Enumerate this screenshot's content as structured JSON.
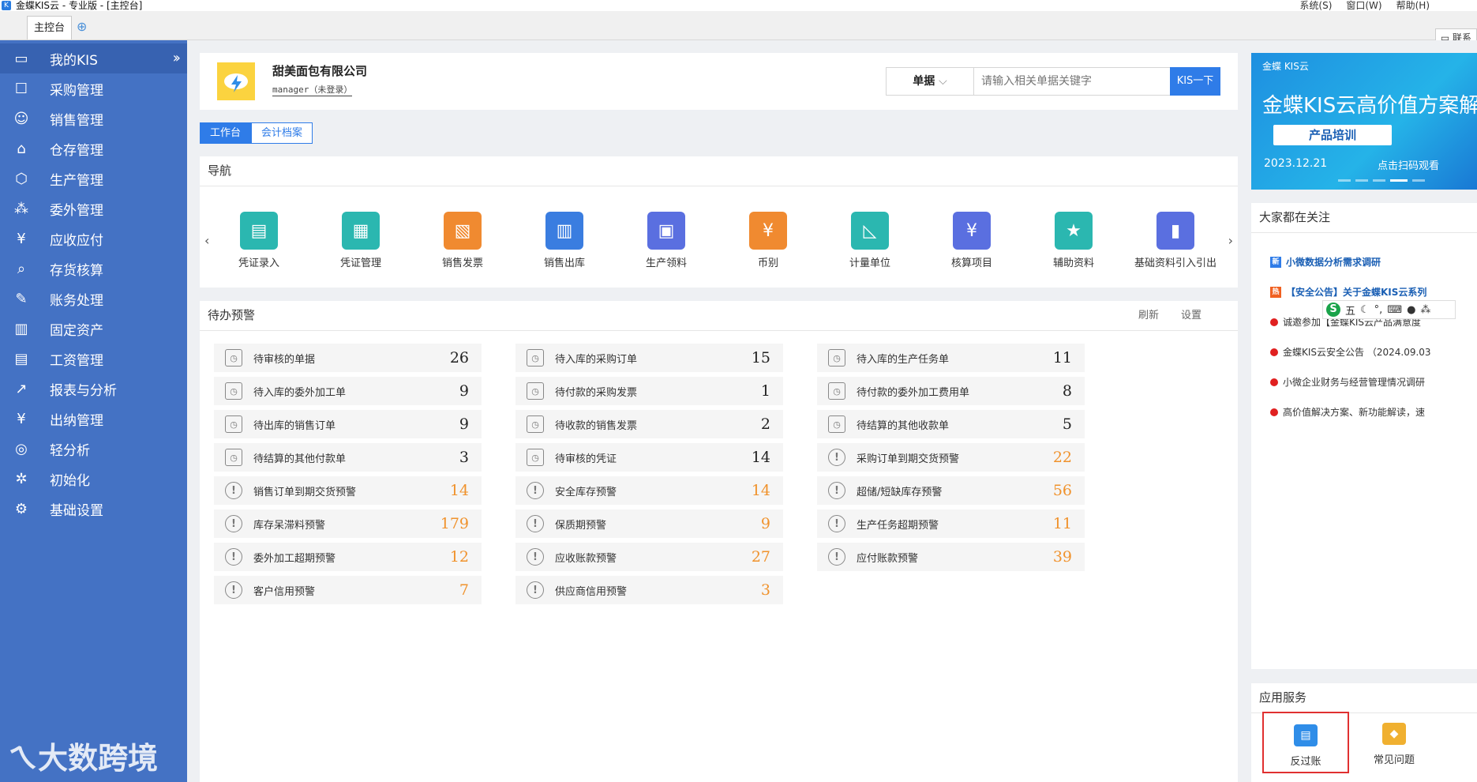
{
  "window": {
    "title": "金蝶KIS云 - 专业版 - [主控台]"
  },
  "menus": [
    "系统(S)",
    "窗口(W)",
    "帮助(H)"
  ],
  "tabs": {
    "main": "主控台",
    "contact": "联系"
  },
  "sidebar": {
    "items": [
      {
        "label": "我的KIS",
        "icon": "monitor-icon"
      },
      {
        "label": "采购管理",
        "icon": "purchase-icon"
      },
      {
        "label": "销售管理",
        "icon": "users-icon"
      },
      {
        "label": "仓存管理",
        "icon": "warehouse-icon"
      },
      {
        "label": "生产管理",
        "icon": "production-icon"
      },
      {
        "label": "委外管理",
        "icon": "outsource-icon"
      },
      {
        "label": "应收应付",
        "icon": "yen-icon"
      },
      {
        "label": "存货核算",
        "icon": "inventory-icon"
      },
      {
        "label": "账务处理",
        "icon": "ledger-icon"
      },
      {
        "label": "固定资产",
        "icon": "building-icon"
      },
      {
        "label": "工资管理",
        "icon": "salary-icon"
      },
      {
        "label": "报表与分析",
        "icon": "chart-icon"
      },
      {
        "label": "出纳管理",
        "icon": "cashier-icon"
      },
      {
        "label": "轻分析",
        "icon": "analysis-icon"
      },
      {
        "label": "初始化",
        "icon": "init-icon"
      },
      {
        "label": "基础设置",
        "icon": "settings-icon"
      }
    ],
    "watermark": "大数跨境"
  },
  "company": {
    "name": "甜美面包有限公司",
    "user": "manager（未登录）"
  },
  "search": {
    "select": "单据",
    "placeholder": "请输入相关单据关键字",
    "button": "KIS一下"
  },
  "views": {
    "workbench": "工作台",
    "archive": "会计档案"
  },
  "nav": {
    "title": "导航",
    "prev": "‹",
    "next": "›",
    "items": [
      {
        "label": "凭证录入",
        "color": "#2bb7b0"
      },
      {
        "label": "凭证管理",
        "color": "#2bb7b0"
      },
      {
        "label": "销售发票",
        "color": "#f08a30"
      },
      {
        "label": "销售出库",
        "color": "#3a7de0"
      },
      {
        "label": "生产领料",
        "color": "#5a6fe0"
      },
      {
        "label": "币别",
        "color": "#f08a30"
      },
      {
        "label": "计量单位",
        "color": "#2bb7b0"
      },
      {
        "label": "核算项目",
        "color": "#5a6fe0"
      },
      {
        "label": "辅助资料",
        "color": "#2bb7b0"
      },
      {
        "label": "基础资料引入引出",
        "color": "#5a6fe0"
      }
    ]
  },
  "todo": {
    "title": "待办预警",
    "refresh": "刷新",
    "settings": "设置",
    "columns": [
      [
        {
          "label": "待审核的单据",
          "value": "26",
          "warn": false
        },
        {
          "label": "待入库的委外加工单",
          "value": "9",
          "warn": false
        },
        {
          "label": "待出库的销售订单",
          "value": "9",
          "warn": false
        },
        {
          "label": "待结算的其他付款单",
          "value": "3",
          "warn": false
        },
        {
          "label": "销售订单到期交货预警",
          "value": "14",
          "warn": true
        },
        {
          "label": "库存呆滞料预警",
          "value": "179",
          "warn": true
        },
        {
          "label": "委外加工超期预警",
          "value": "12",
          "warn": true
        },
        {
          "label": "客户信用预警",
          "value": "7",
          "warn": true
        }
      ],
      [
        {
          "label": "待入库的采购订单",
          "value": "15",
          "warn": false
        },
        {
          "label": "待付款的采购发票",
          "value": "1",
          "warn": false
        },
        {
          "label": "待收款的销售发票",
          "value": "2",
          "warn": false
        },
        {
          "label": "待审核的凭证",
          "value": "14",
          "warn": false
        },
        {
          "label": "安全库存预警",
          "value": "14",
          "warn": true
        },
        {
          "label": "保质期预警",
          "value": "9",
          "warn": true
        },
        {
          "label": "应收账款预警",
          "value": "27",
          "warn": true
        },
        {
          "label": "供应商信用预警",
          "value": "3",
          "warn": true
        }
      ],
      [
        {
          "label": "待入库的生产任务单",
          "value": "11",
          "warn": false
        },
        {
          "label": "待付款的委外加工费用单",
          "value": "8",
          "warn": false
        },
        {
          "label": "待结算的其他收款单",
          "value": "5",
          "warn": false
        },
        {
          "label": "采购订单到期交货预警",
          "value": "22",
          "warn": true
        },
        {
          "label": "超储/短缺库存预警",
          "value": "56",
          "warn": true
        },
        {
          "label": "生产任务超期预警",
          "value": "11",
          "warn": true
        },
        {
          "label": "应付账款预警",
          "value": "39",
          "warn": true
        }
      ]
    ]
  },
  "banner": {
    "brand": "金蝶 KIS云",
    "headline": "金蝶KIS云高价值方案解读",
    "pill": "产品培训",
    "date": "2023.12.21",
    "scan": "点击扫码观看"
  },
  "focus": {
    "title": "大家都在关注",
    "items": [
      {
        "label": "小微数据分析需求调研",
        "style": "new"
      },
      {
        "label": "【安全公告】关于金蝶KIS云系列",
        "style": "hot"
      },
      {
        "label": "诚邀参加【金蝶KIS云产品满意度",
        "style": "dot"
      },
      {
        "label": "金蝶KIS云安全公告 （2024.09.03",
        "style": "dot"
      },
      {
        "label": "小微企业财务与经营管理情况调研",
        "style": "dot"
      },
      {
        "label": "高价值解决方案、新功能解读，速",
        "style": "dot"
      }
    ],
    "new_tag": "新",
    "hot_tag": "热"
  },
  "ime": {
    "logo": "S",
    "mode": "五"
  },
  "services": {
    "title": "应用服务",
    "items": [
      {
        "label": "反过账",
        "color": "#2f8de8"
      },
      {
        "label": "常见问题",
        "color": "#f0b030"
      }
    ]
  }
}
